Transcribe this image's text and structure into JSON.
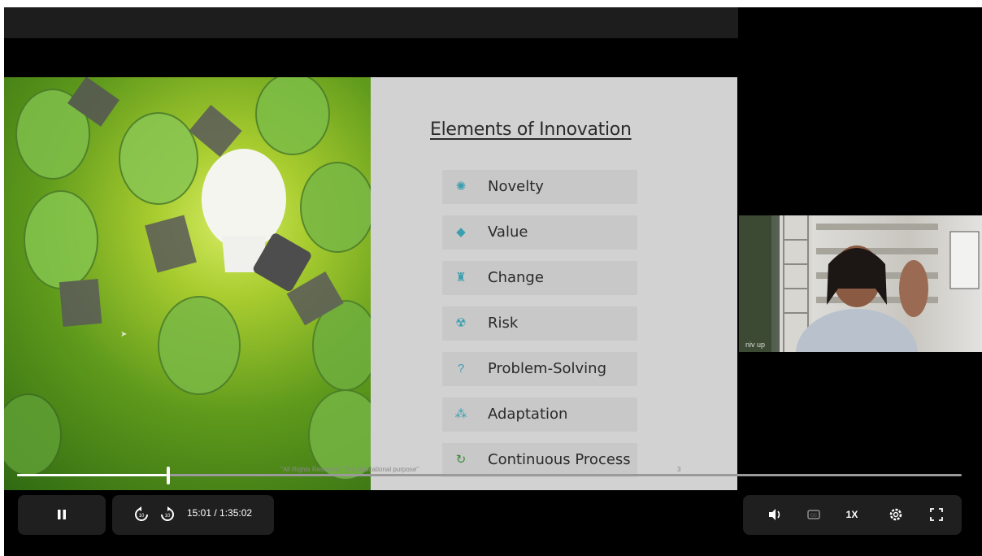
{
  "slide": {
    "title": "Elements of Innovation",
    "elements": [
      {
        "label": "Novelty",
        "icon": "sun-icon",
        "glyph": "✺"
      },
      {
        "label": "Value",
        "icon": "piggy-bank-icon",
        "glyph": "◆"
      },
      {
        "label": "Change",
        "icon": "chess-piece-icon",
        "glyph": "♜"
      },
      {
        "label": "Risk",
        "icon": "radiation-icon",
        "glyph": "☢"
      },
      {
        "label": "Problem-Solving",
        "icon": "question-icon",
        "glyph": "?"
      },
      {
        "label": "Adaptation",
        "icon": "network-icon",
        "glyph": "⁂"
      },
      {
        "label": "Continuous Process",
        "icon": "cycle-icon",
        "glyph": "↻"
      }
    ],
    "footer": "\"All Rights Reserved\" \"For educational purpose\"",
    "page_number": "3",
    "accent_color": "#3a9fb0"
  },
  "webcam": {
    "name": "niv up"
  },
  "player": {
    "time": "15:01 / 1:35:02",
    "progress": 0.158,
    "speed_label": "1X",
    "pause_icon": "pause-icon",
    "rewind_icon": "rewind-10-icon",
    "forward_icon": "forward-10-icon",
    "volume_icon": "volume-icon",
    "cc_icon": "captions-icon",
    "settings_icon": "gear-icon",
    "fullscreen_icon": "fullscreen-icon"
  }
}
